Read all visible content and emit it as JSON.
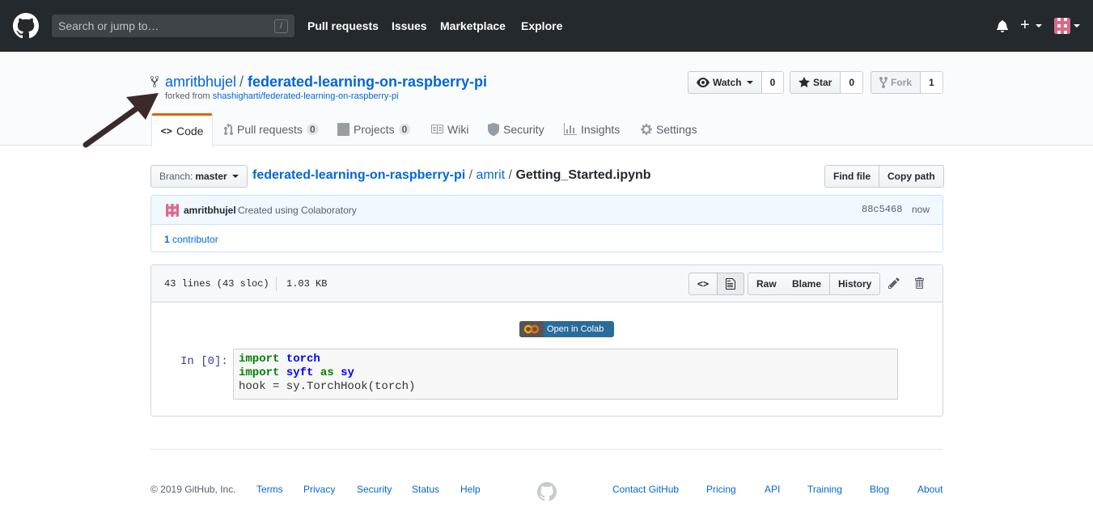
{
  "header": {
    "search_placeholder": "Search or jump to…",
    "search_shortcut": "/",
    "nav": [
      "Pull requests",
      "Issues",
      "Marketplace",
      "Explore"
    ]
  },
  "repo": {
    "owner": "amritbhujel",
    "separator": "/",
    "name": "federated-learning-on-raspberry-pi",
    "forked_from_prefix": "forked from",
    "forked_from": "shashigharti/federated-learning-on-raspberry-pi",
    "watch_label": "Watch",
    "watch_count": "0",
    "star_label": "Star",
    "star_count": "0",
    "fork_label": "Fork",
    "fork_count": "1"
  },
  "tabs": [
    {
      "label": "Code",
      "icon": "code-icon"
    },
    {
      "label": "Pull requests",
      "badge": "0",
      "icon": "pull-request-icon"
    },
    {
      "label": "Projects",
      "badge": "0",
      "icon": "project-icon"
    },
    {
      "label": "Wiki",
      "icon": "book-icon"
    },
    {
      "label": "Security",
      "icon": "shield-icon"
    },
    {
      "label": "Insights",
      "icon": "graph-icon"
    },
    {
      "label": "Settings",
      "icon": "gear-icon"
    }
  ],
  "file_nav": {
    "branch_prefix": "Branch:",
    "branch": "master",
    "crumb_repo": "federated-learning-on-raspberry-pi",
    "crumb_sep": "/",
    "crumb_dir": "amrit",
    "crumb_file": "Getting_Started.ipynb",
    "find_file": "Find file",
    "copy_path": "Copy path"
  },
  "commit": {
    "author": "amritbhujel",
    "message": "Created using Colaboratory",
    "sha": "88c5468",
    "time": "now",
    "contributors_count": "1",
    "contributors_label": "contributor"
  },
  "file": {
    "lines": "43 lines (43 sloc)",
    "size": "1.03 KB",
    "raw": "Raw",
    "blame": "Blame",
    "history": "History",
    "colab_badge": "Open in Colab",
    "prompt": "In [0]:",
    "code": [
      [
        {
          "t": "kw",
          "v": "import"
        },
        {
          "t": "tx",
          "v": " "
        },
        {
          "t": "nm",
          "v": "torch"
        }
      ],
      [
        {
          "t": "kw",
          "v": "import"
        },
        {
          "t": "tx",
          "v": " "
        },
        {
          "t": "nm",
          "v": "syft"
        },
        {
          "t": "tx",
          "v": " "
        },
        {
          "t": "kw",
          "v": "as"
        },
        {
          "t": "tx",
          "v": " "
        },
        {
          "t": "nm",
          "v": "sy"
        }
      ],
      [
        {
          "t": "tx",
          "v": "hook = sy.TorchHook(torch)"
        }
      ]
    ]
  },
  "footer": {
    "copyright": "© 2019 GitHub, Inc.",
    "left_links": [
      "Terms",
      "Privacy",
      "Security",
      "Status",
      "Help"
    ],
    "right_links": [
      "Contact GitHub",
      "Pricing",
      "API",
      "Training",
      "Blog",
      "About"
    ]
  },
  "colors": {
    "header_bg": "#24292e",
    "link": "#0366d6",
    "tab_accent": "#e36209"
  }
}
